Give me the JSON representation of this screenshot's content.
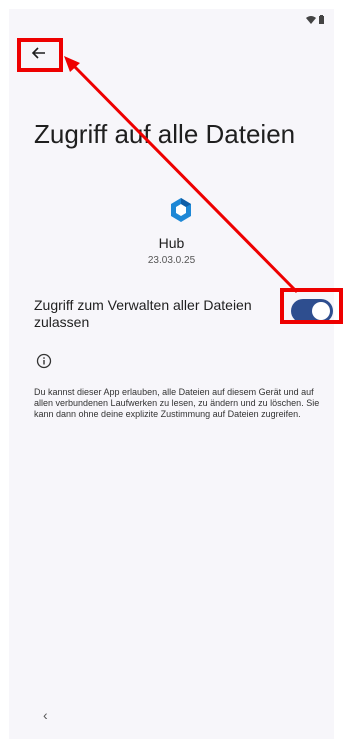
{
  "status": {
    "wifi_icon": "wifi-icon",
    "battery_icon": "battery-icon"
  },
  "header": {
    "back_icon": "arrow-back-icon"
  },
  "page": {
    "title": "Zugriff auf alle Dateien"
  },
  "app": {
    "icon": "hub-app-icon",
    "name": "Hub",
    "version": "23.03.0.25"
  },
  "setting": {
    "label": "Zugriff zum Verwalten aller Dateien zulassen",
    "enabled": true
  },
  "info": {
    "icon": "info-icon",
    "description": "Du kannst dieser App erlauben, alle Dateien auf diesem Gerät und auf allen verbundenen Laufwerken zu lesen, zu ändern und zu löschen. Sie kann dann ohne deine explizite Zustimmung auf Dateien zugreifen."
  },
  "navbar": {
    "back_glyph": "‹"
  },
  "colors": {
    "background": "#f7f6fa",
    "toggle_on": "#2e4e8f",
    "annotation": "#ee0000",
    "app_icon": "#1e88d6"
  }
}
